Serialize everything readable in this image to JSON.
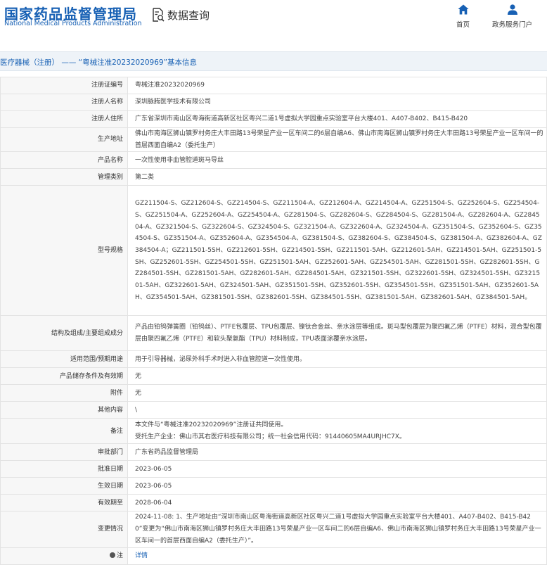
{
  "header": {
    "logo_cn": "国家药品监督管理局",
    "logo_en": "National Medical Products Administration",
    "query_title": "数据查询",
    "nav_home": "首页",
    "nav_portal": "政务服务门户"
  },
  "breadcrumb": "医疗器械（注册） —— “粤械注准20232020969”基本信息",
  "colors": {
    "brand": "#1760b4",
    "label_bg": "#f7f7f7",
    "crumb_bg": "#eef3f8"
  },
  "rows": [
    {
      "label": "注册证编号",
      "value": "粤械注准20232020969"
    },
    {
      "label": "注册人名称",
      "value": "深圳脉腾医学技术有限公司"
    },
    {
      "label": "注册人住所",
      "value": "广东省深圳市南山区粤海街道高新区社区粤兴二道1号虚拟大学园重点实验室平台大楼401、A407-B402、B415-B420"
    },
    {
      "label": "生产地址",
      "value": "佛山市南海区狮山镇罗村务庄大丰田路13号荣星产业一区车间二的6层自编A6、佛山市南海区狮山镇罗村务庄大丰田路13号荣星产业一区车间一的首层西面自编A2（委托生产）"
    },
    {
      "label": "产品名称",
      "value": "一次性使用非血管腔道斑马导丝"
    },
    {
      "label": "管理类别",
      "value": "第二类"
    },
    {
      "label": "型号规格",
      "value": "GZ211504-S、GZ212604-S、GZ214504-S、GZ211504-A、GZ212604-A、GZ214504-A、GZ251504-S、GZ252604-S、GZ254504-S、GZ251504-A、GZ252604-A、GZ254504-A、GZ281504-S、GZ282604-S、GZ284504-S、GZ281504-A、GZ282604-A、GZ284504-A、GZ321504-S、GZ322604-S、GZ324504-S、GZ321504-A、GZ322604-A、GZ324504-A、GZ351504-S、GZ352604-S、GZ354504-S、GZ351504-A、GZ352604-A、GZ354504-A、GZ381504-S、GZ382604-S、GZ384504-S、GZ381504-A、GZ382604-A、GZ384504-A；GZ211501-5SH、GZ212601-5SH、GZ214501-5SH、GZ211501-5AH、GZ212601-5AH、GZ214501-5AH、GZ251501-5SH、GZ252601-5SH、GZ254501-5SH、GZ251501-5AH、GZ252601-5AH、GZ254501-5AH、GZ281501-5SH、GZ282601-5SH、GZ284501-5SH、GZ281501-5AH、GZ282601-5AH、GZ284501-5AH、GZ321501-5SH、GZ322601-5SH、GZ324501-5SH、GZ321501-5AH、GZ322601-5AH、GZ324501-5AH、GZ351501-5SH、GZ352601-5SH、GZ354501-5SH、GZ351501-5AH、GZ352601-5AH、GZ354501-5AH、GZ381501-5SH、GZ382601-5SH、GZ384501-5SH、GZ381501-5AH、GZ382601-5AH、GZ384501-5AH。"
    },
    {
      "label": "结构及组成/主要组成成分",
      "value": "产品由铂钨弹簧圈（铂钨丝）、PTFE包覆层、TPU包覆层、镍钛合金丝、亲水涂层等组成。斑马型包覆层为聚四氟乙烯（PTFE）材料，混合型包覆层由聚四氟乙烯（PTFE）和软头聚氨酯（TPU）材料制成，TPU表面涂覆亲水涂层。"
    },
    {
      "label": "适用范围/预期用途",
      "value": "用于引导器械，泌尿外科手术时进入非血管腔道一次性使用。"
    },
    {
      "label": "产品储存条件及有效期",
      "value": "无"
    },
    {
      "label": "附件",
      "value": "无"
    },
    {
      "label": "其他内容",
      "value": "\\"
    },
    {
      "label": "备注",
      "value": "本文件与“粤械注准20232020969”注册证共同使用。\n受托生产企业：佛山市其右医疗科技有限公司；统一社会信用代码：91440605MA4URJHC7X。"
    },
    {
      "label": "审批部门",
      "value": "广东省药品监督管理局"
    },
    {
      "label": "批准日期",
      "value": "2023-06-05"
    },
    {
      "label": "生效日期",
      "value": "2023-06-05"
    },
    {
      "label": "有效期至",
      "value": "2028-06-04"
    },
    {
      "label": "变更情况",
      "value": "2024-11-08: 1、生产地址由“深圳市南山区粤海街道高新区社区粤兴二道1号虚拟大学园重点实验室平台大楼401、A407-B402、B415-B420”变更为“佛山市南海区狮山镇罗村务庄大丰田路13号荣星产业一区车间二的6层自编A6、佛山市南海区狮山镇罗村务庄大丰田路13号荣星产业一区车间一的首层西面自编A2（委托生产）”。"
    }
  ],
  "note_row": {
    "label": "注",
    "value": "详情",
    "icon": "pin-icon"
  }
}
